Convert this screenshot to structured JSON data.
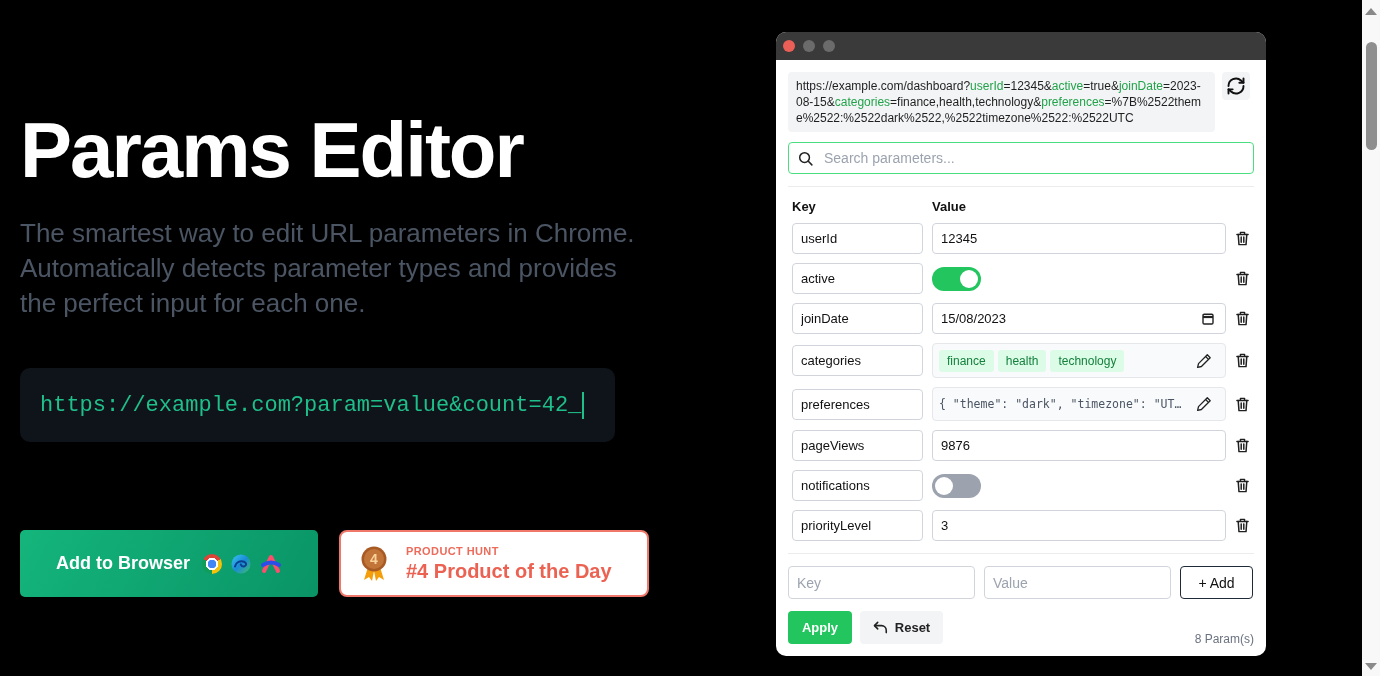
{
  "hero": {
    "title": "Params Editor",
    "subtitle": "The smartest way to edit URL parameters in Chrome. Automatically detects parameter types and provides the perfect input for each one.",
    "code_sample": "https://example.com?param=value&count=42_"
  },
  "actions": {
    "add_button": "Add to Browser",
    "badge": {
      "rank": "4",
      "eyebrow": "PRODUCT HUNT",
      "title": "#4 Product of the Day"
    }
  },
  "popup": {
    "window_controls": [
      {
        "color": "#ec5f57"
      },
      {
        "color": "#6b6b6b"
      },
      {
        "color": "#6b6b6b"
      }
    ],
    "url": [
      {
        "text": "https://example.com/dashboard?",
        "kind": "plain"
      },
      {
        "text": "userId",
        "kind": "key"
      },
      {
        "text": "=12345&",
        "kind": "plain"
      },
      {
        "text": "active",
        "kind": "key"
      },
      {
        "text": "=true&",
        "kind": "plain"
      },
      {
        "text": "joinDate",
        "kind": "key"
      },
      {
        "text": "=2023-08-15&",
        "kind": "plain"
      },
      {
        "text": "categories",
        "kind": "key"
      },
      {
        "text": "=finance,health,technology&",
        "kind": "plain"
      },
      {
        "text": "preferences",
        "kind": "key"
      },
      {
        "text": "=%7B%2522theme%2522:%2522dark%2522,%2522timezone%2522:%2522UTC",
        "kind": "plain"
      }
    ],
    "search": {
      "placeholder": "Search parameters...",
      "focused": true
    },
    "columns": [
      "Key",
      "Value"
    ],
    "params": [
      {
        "key": "userId",
        "kind": "text",
        "value": "12345"
      },
      {
        "key": "active",
        "kind": "toggle",
        "on": true
      },
      {
        "key": "joinDate",
        "kind": "date",
        "value": "15/08/2023"
      },
      {
        "key": "categories",
        "kind": "tags",
        "tags": [
          "finance",
          "health",
          "technology"
        ]
      },
      {
        "key": "preferences",
        "kind": "json",
        "value": "{ \"theme\": \"dark\", \"timezone\": \"UT…"
      },
      {
        "key": "pageViews",
        "kind": "text",
        "value": "9876"
      },
      {
        "key": "notifications",
        "kind": "toggle",
        "on": false
      },
      {
        "key": "priorityLevel",
        "kind": "text",
        "value": "3"
      }
    ],
    "new_param": {
      "key_placeholder": "Key",
      "value_placeholder": "Value",
      "add_button": "+ Add"
    },
    "apply_button": "Apply",
    "reset_button": "Reset",
    "count": "8 Param(s)"
  }
}
